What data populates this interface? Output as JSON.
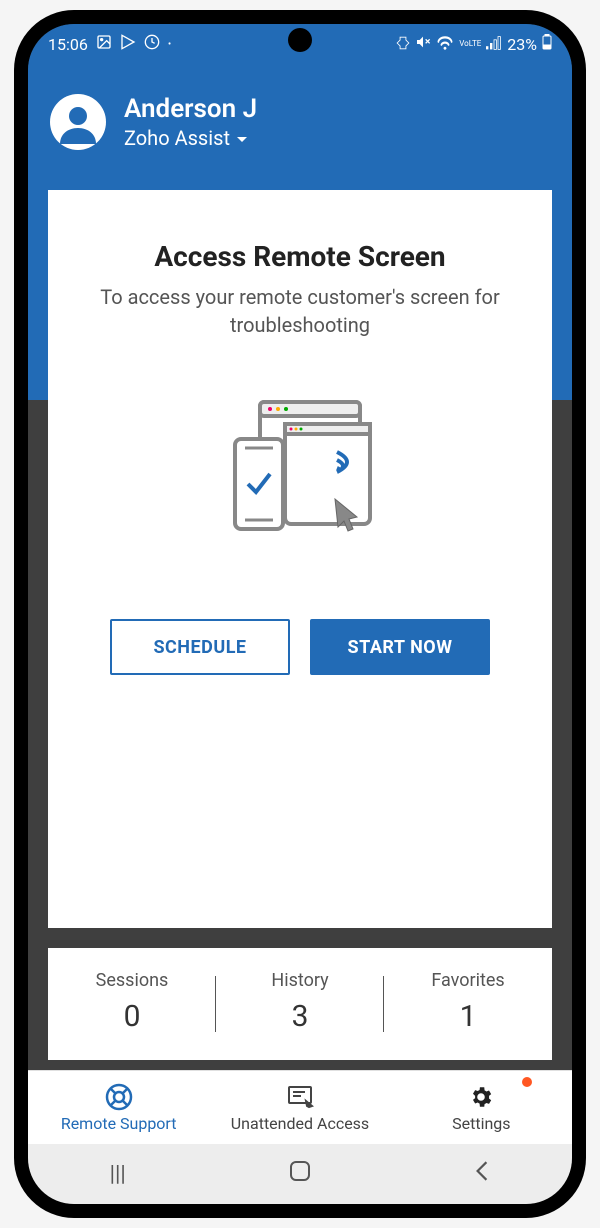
{
  "status": {
    "time": "15:06",
    "battery": "23%"
  },
  "header": {
    "user_name": "Anderson J",
    "org_name": "Zoho Assist"
  },
  "card": {
    "title": "Access Remote Screen",
    "subtitle": "To access your remote customer's screen for troubleshooting",
    "schedule_label": "SCHEDULE",
    "start_label": "START NOW"
  },
  "stats": [
    {
      "label": "Sessions",
      "value": "0"
    },
    {
      "label": "History",
      "value": "3"
    },
    {
      "label": "Favorites",
      "value": "1"
    }
  ],
  "nav": {
    "remote": "Remote Support",
    "unattended": "Unattended Access",
    "settings": "Settings"
  }
}
